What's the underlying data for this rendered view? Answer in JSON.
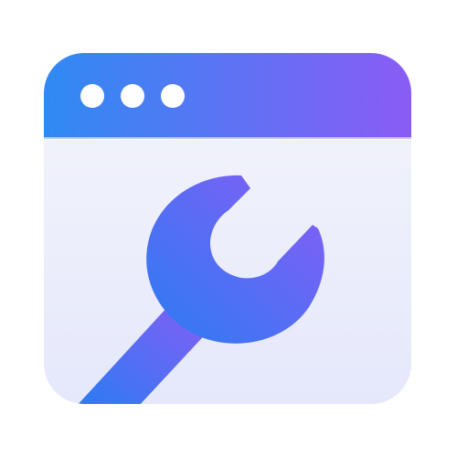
{
  "icon": {
    "name": "browser-settings-app-icon",
    "parts": [
      "window-titlebar",
      "window-dots",
      "wrench-icon"
    ],
    "colors": {
      "titlebar_start": "#2f8af2",
      "titlebar_end": "#8a5cf6",
      "body_top": "#f4f5fb",
      "body_bottom": "#e5e8fb",
      "wrench_start": "#2a7cf2",
      "wrench_end": "#8a5cf6",
      "dot": "#ffffff"
    }
  }
}
